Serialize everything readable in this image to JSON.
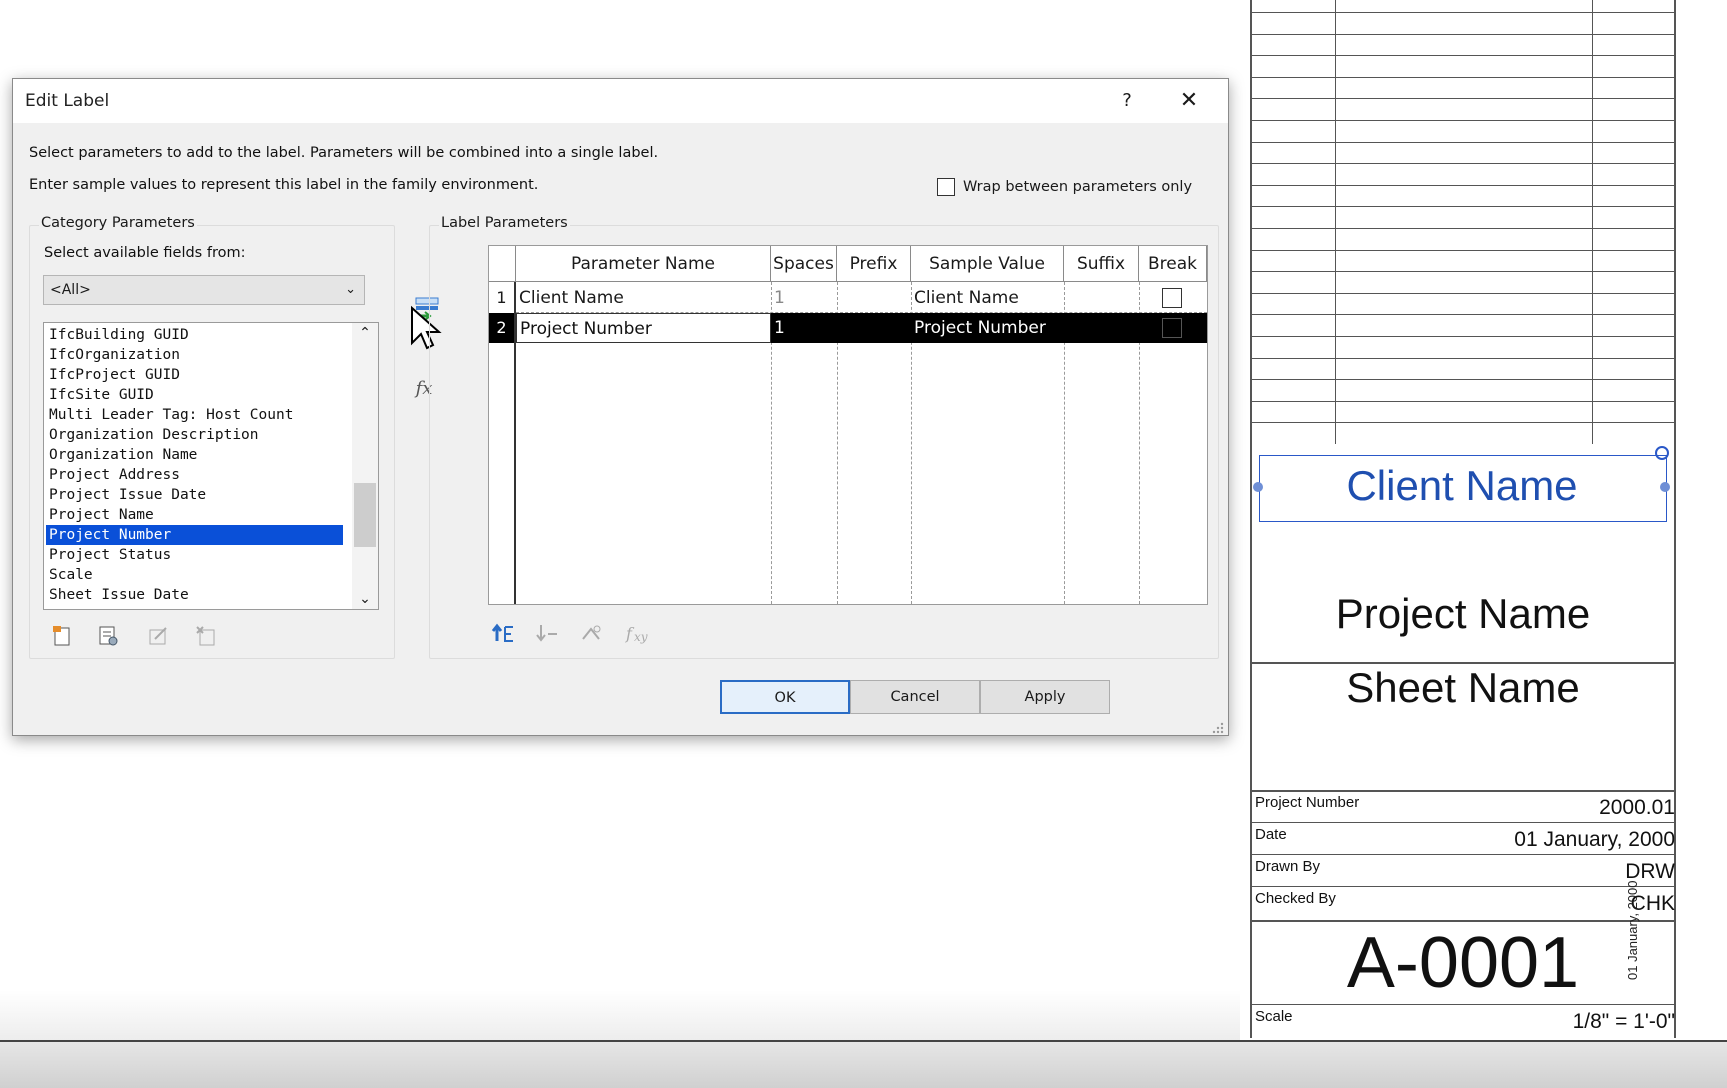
{
  "dialog": {
    "title": "Edit Label",
    "help": "?",
    "close": "✕",
    "instruction_1": "Select parameters to add to the label.  Parameters will be combined into a single label.",
    "instruction_2": "Enter sample values to represent this label in the family environment.",
    "wrap_label": "Wrap between parameters only",
    "category_group_title": "Category Parameters",
    "select_fields_label": "Select available fields from:",
    "select_value": "<All>",
    "list_items": [
      "IfcBuilding GUID",
      "IfcOrganization",
      "IfcProject GUID",
      "IfcSite GUID",
      "Multi Leader Tag: Host Count",
      "Organization Description",
      "Organization Name",
      "Project Address",
      "Project Issue Date",
      "Project Name",
      "Project Number",
      "Project Status",
      "Scale",
      "Sheet Issue Date"
    ],
    "selected_item": "Project Number",
    "label_group_title": "Label Parameters",
    "columns": [
      "Parameter Name",
      "Spaces",
      "Prefix",
      "Sample Value",
      "Suffix",
      "Break"
    ],
    "rows": [
      {
        "num": "1",
        "name": "Client Name",
        "spaces": "1",
        "prefix": "",
        "sample": "Client Name",
        "suffix": "",
        "break": false
      },
      {
        "num": "2",
        "name": "Project Number",
        "spaces": "1",
        "prefix": "",
        "sample": "Project Number",
        "suffix": "",
        "break": false
      }
    ],
    "fx": "fx",
    "buttons": {
      "ok": "OK",
      "cancel": "Cancel",
      "apply": "Apply"
    }
  },
  "titleblock": {
    "client_name": "Client Name",
    "project_name": "Project Name",
    "sheet_name": "Sheet Name",
    "fields": [
      {
        "label": "Project Number",
        "value": "2000.01"
      },
      {
        "label": "Date",
        "value": "01 January, 2000"
      },
      {
        "label": "Drawn By",
        "value": "DRW"
      },
      {
        "label": "Checked By",
        "value": "CHK"
      }
    ],
    "sheet_number": "A-0001",
    "scale_label": "Scale",
    "scale_value": "1/8\" = 1'-0\"",
    "vertical_date": "01 January, 2000"
  },
  "colors": {
    "selection": "#0a50d8",
    "accent": "#2a6cc5",
    "label_blue": "#1f4fb0"
  }
}
